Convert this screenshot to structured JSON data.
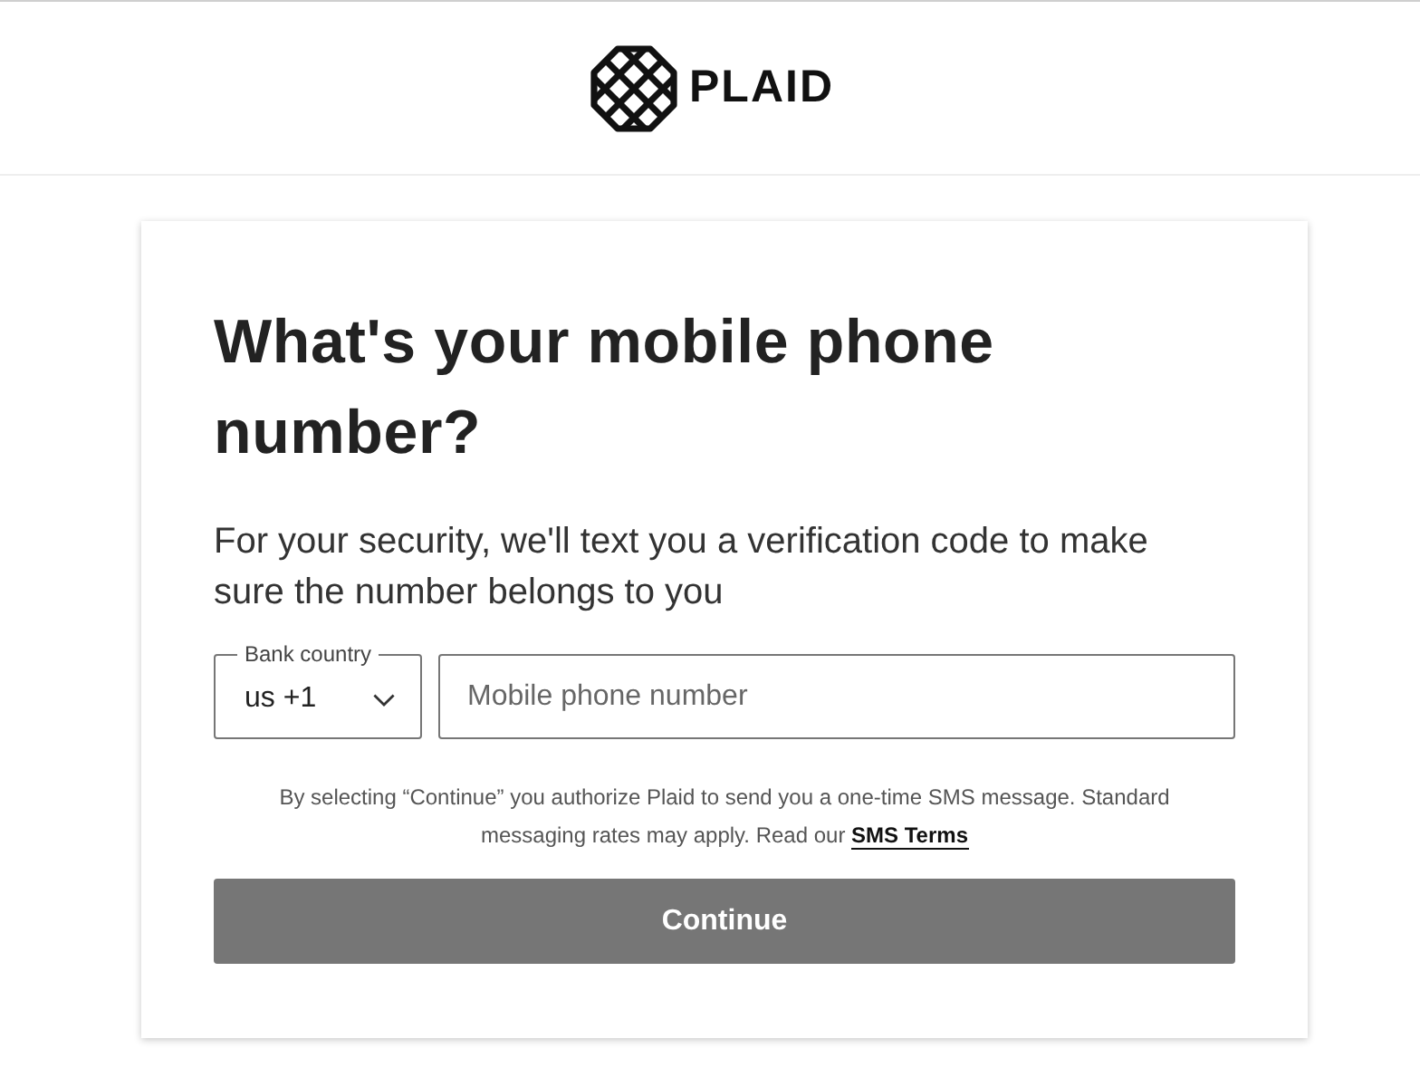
{
  "header": {
    "logo_text": "PLAID"
  },
  "card": {
    "title": "What's your mobile phone number?",
    "subtitle": "For your security, we'll text you a verification code to make sure the number belongs to you",
    "country_select": {
      "label": "Bank country",
      "value": "us +1"
    },
    "phone_field": {
      "placeholder": "Mobile phone number"
    },
    "legal": {
      "text": "By selecting “Continue” you authorize Plaid to send you a one-time SMS message. Standard messaging rates may apply. Read our",
      "link": "SMS Terms"
    },
    "continue_button": {
      "label": "Continue",
      "disabled": true
    }
  }
}
